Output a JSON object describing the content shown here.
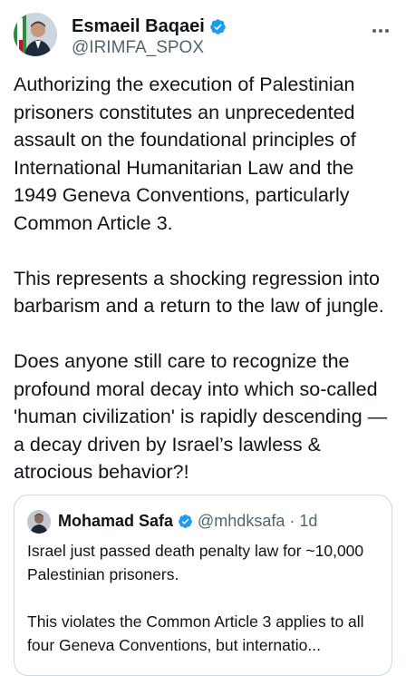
{
  "author": {
    "display_name": "Esmaeil Baqaei",
    "handle": "@IRIMFA_SPOX",
    "verified": true,
    "verified_color": "#1d9bf0"
  },
  "tweet": {
    "paragraphs": [
      "Authorizing the execution of Palestinian prisoners constitutes an unprecedented assault on the foundational principles of International Humanitarian Law and the 1949 Geneva Conventions, particularly Common Article 3.",
      "This represents a shocking regression into barbarism and a return to the law of jungle.",
      "Does anyone still care to recognize the profound moral decay into which so-called 'human civilization' is rapidly descending — a decay driven by Israel’s lawless & atrocious behavior?!"
    ]
  },
  "quoted_tweet": {
    "display_name": "Mohamad Safa",
    "handle": "@mhdksafa",
    "separator": "·",
    "time": "1d",
    "verified": true,
    "paragraphs": [
      "Israel just passed death penalty law for ~10,000 Palestinian prisoners.",
      "This violates the Common Article 3 applies to all four Geneva Conventions, but internatio..."
    ]
  },
  "icons": {
    "verified": "verified-badge-icon",
    "more": "more-options-icon"
  }
}
